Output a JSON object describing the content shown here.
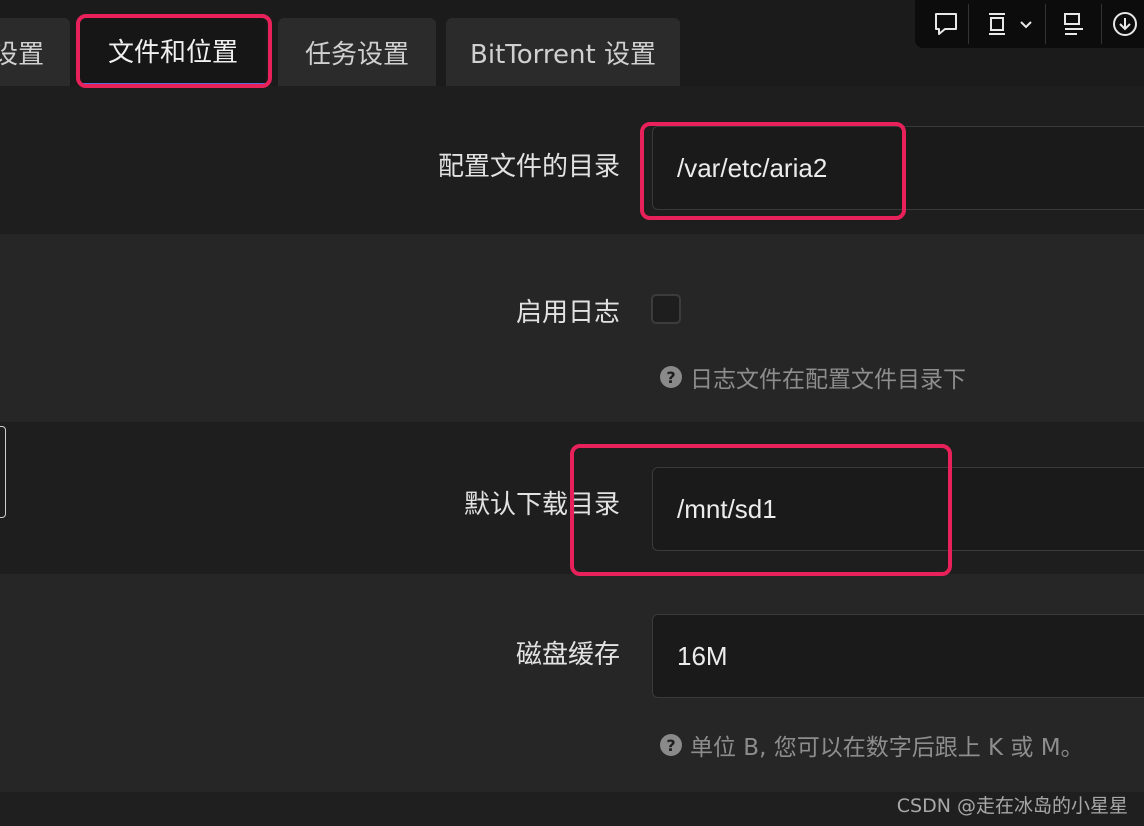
{
  "tabs": [
    {
      "label": "设置"
    },
    {
      "label": "文件和位置"
    },
    {
      "label": "任务设置"
    },
    {
      "label": "BitTorrent 设置"
    }
  ],
  "settings": {
    "config_dir": {
      "label": "配置文件的目录",
      "value": "/var/etc/aria2"
    },
    "enable_log": {
      "label": "启用日志",
      "checked": false,
      "hint": "日志文件在配置文件目录下"
    },
    "download_dir": {
      "label": "默认下载目录",
      "value": "/mnt/sd1"
    },
    "disk_cache": {
      "label": "磁盘缓存",
      "value": "16M",
      "hint": "单位 B, 您可以在数字后跟上 K 或 M。"
    }
  },
  "hint_icon": "?",
  "toolbar_icons": [
    "comment-icon",
    "screenshot-icon",
    "chevron-down-icon",
    "align-icon",
    "download-icon"
  ],
  "watermark": "CSDN @走在冰岛的小星星",
  "colors": {
    "highlight": "#e8215b",
    "tab_active_underline": "#5a6bd8",
    "background": "#1f1f1f"
  }
}
